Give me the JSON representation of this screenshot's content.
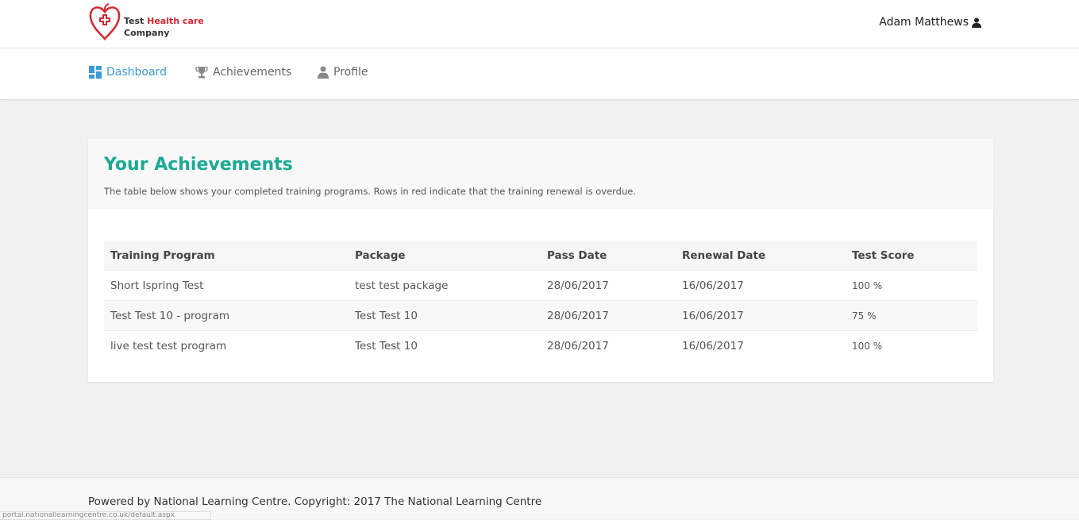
{
  "brand": {
    "line1_a": "Test ",
    "line1_b": "Health care",
    "line2": "Company",
    "accent": "#d9262f"
  },
  "user": {
    "name": "Adam Matthews",
    "icon": "user-icon"
  },
  "nav": {
    "items": [
      {
        "label": "Dashboard",
        "icon": "dashboard-icon",
        "active": true
      },
      {
        "label": "Achievements",
        "icon": "trophy-icon",
        "active": false
      },
      {
        "label": "Profile",
        "icon": "user-icon",
        "active": false
      }
    ],
    "active_color": "#3a9bd6"
  },
  "achievements": {
    "title": "Your Achievements",
    "subtitle": "The table below shows your completed training programs. Rows in red indicate that the training renewal is overdue.",
    "title_color": "#1aaa94",
    "columns": [
      "Training Program",
      "Package",
      "Pass Date",
      "Renewal Date",
      "Test Score"
    ],
    "rows": [
      [
        "Short Ispring Test",
        "test test package",
        "28/06/2017",
        "16/06/2017",
        "100 %"
      ],
      [
        "Test Test 10 - program",
        "Test Test 10",
        "28/06/2017",
        "16/06/2017",
        "75 %"
      ],
      [
        "live test test program",
        "Test Test 10",
        "28/06/2017",
        "16/06/2017",
        "100 %"
      ]
    ]
  },
  "footer": {
    "text": "Powered by National Learning Centre. Copyright: 2017 The National Learning Centre"
  },
  "status_bar": {
    "url": "portal.nationallearningcentre.co.uk/default.aspx"
  }
}
